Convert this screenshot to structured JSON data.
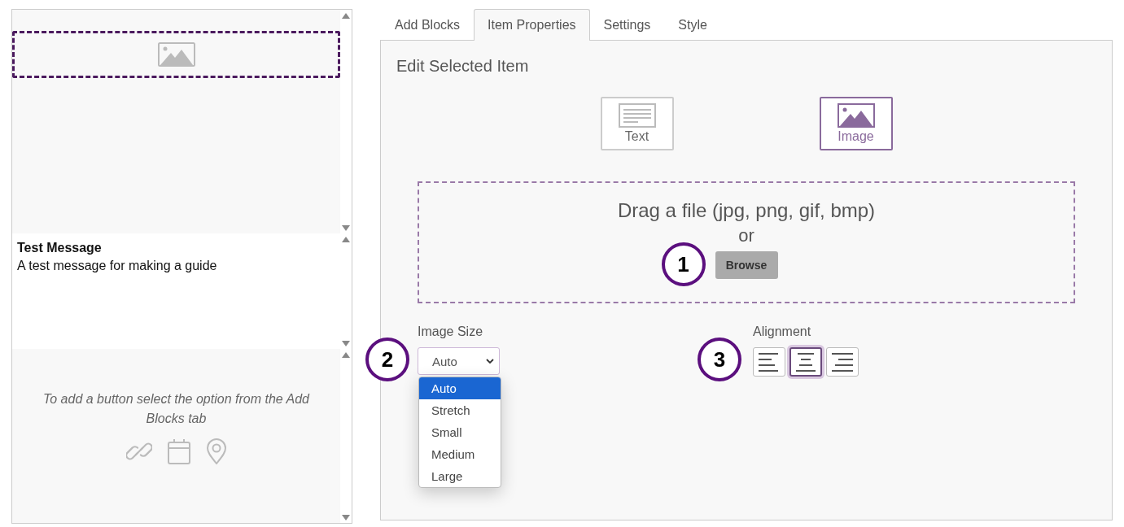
{
  "preview": {
    "blocks": [
      {
        "kind": "image",
        "selected": true
      },
      {
        "kind": "message",
        "title": "Test Message",
        "body": "A test message for making a guide"
      },
      {
        "kind": "buttons",
        "hint": "To add a button select the option from the Add Blocks tab"
      }
    ]
  },
  "tabs": [
    {
      "label": "Add Blocks",
      "selected": false
    },
    {
      "label": "Item Properties",
      "selected": true
    },
    {
      "label": "Settings",
      "selected": false
    },
    {
      "label": "Style",
      "selected": false
    }
  ],
  "editor": {
    "heading": "Edit Selected Item",
    "types": [
      {
        "kind": "text",
        "label": "Text",
        "selected": false
      },
      {
        "kind": "image",
        "label": "Image",
        "selected": true
      }
    ],
    "dropzone": {
      "prompt": "Drag a file (jpg, png, gif, bmp)",
      "or": "or",
      "button": "Browse",
      "callout": "1"
    },
    "image_size": {
      "label": "Image Size",
      "value": "Auto",
      "expanded": true,
      "callout": "2",
      "options": [
        {
          "label": "Auto",
          "selected": true
        },
        {
          "label": "Stretch",
          "selected": false
        },
        {
          "label": "Small",
          "selected": false
        },
        {
          "label": "Medium",
          "selected": false
        },
        {
          "label": "Large",
          "selected": false
        }
      ]
    },
    "alignment": {
      "label": "Alignment",
      "callout": "3",
      "options": [
        {
          "kind": "left",
          "selected": false
        },
        {
          "kind": "center",
          "selected": true
        },
        {
          "kind": "right",
          "selected": false
        }
      ]
    }
  }
}
